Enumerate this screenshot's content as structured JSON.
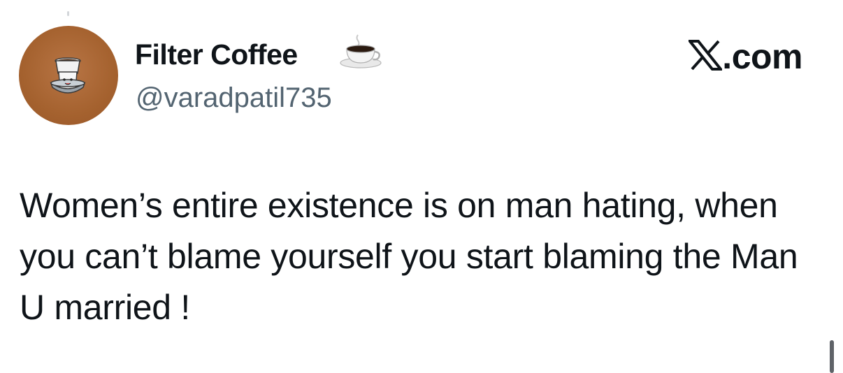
{
  "author": {
    "display_name": "Filter Coffee",
    "display_name_emoji": "coffee-cup-icon",
    "handle": "@varadpatil735",
    "avatar_icon": "filter-coffee-mascot-icon"
  },
  "brand": {
    "label": ".com",
    "logo_icon": "x-logo-icon"
  },
  "tweet": {
    "text": "Women’s entire existence is on man hating, when you can’t blame yourself you start blaming the Man U married !"
  },
  "colors": {
    "text": "#0f1419",
    "handle": "#536471",
    "avatar_bg": "#a5622f"
  }
}
